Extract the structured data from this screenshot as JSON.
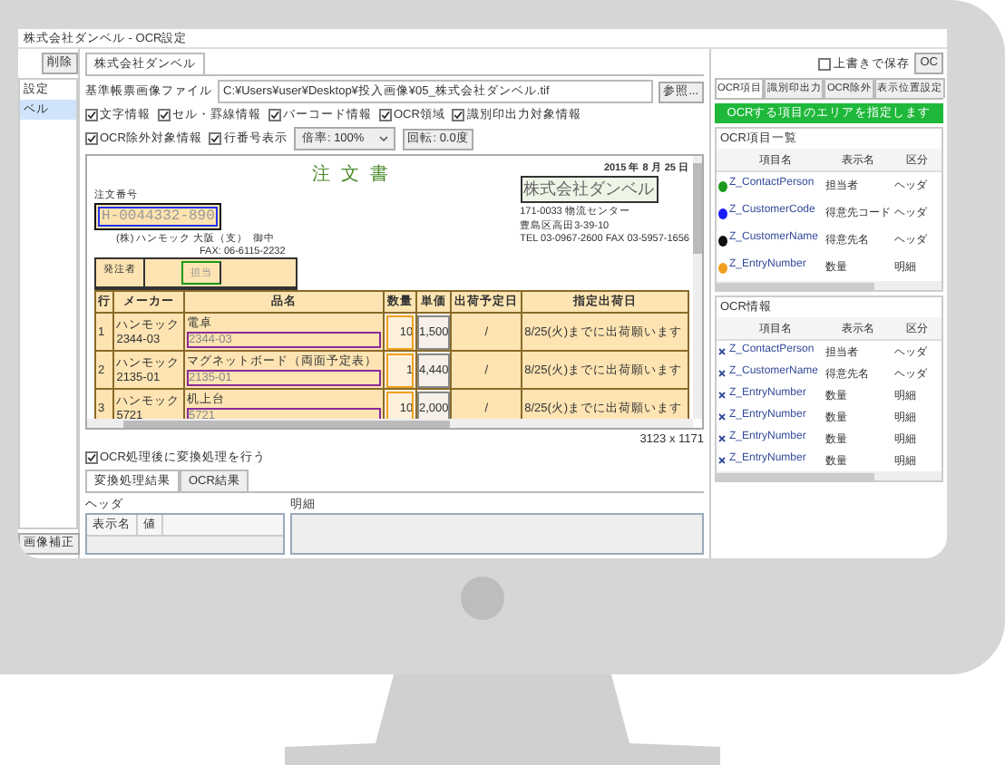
{
  "window": {
    "title": "株式会社ダンベル - OCR設定"
  },
  "left_panel": {
    "button": "削除",
    "items": [
      {
        "label": "設定",
        "selected": false
      },
      {
        "label": "ベル",
        "selected": true
      }
    ],
    "footer_button": "画像補正"
  },
  "document_tab": {
    "label": "株式会社ダンベル"
  },
  "file_row": {
    "label": "基準帳票画像ファイル",
    "value": "C:¥Users¥user¥Desktop¥投入画像¥05_株式会社ダンベル.tif",
    "button": "参照..."
  },
  "display_options": [
    {
      "label": "文字情報",
      "checked": true
    },
    {
      "label": "セル・罫線情報",
      "checked": true
    },
    {
      "label": "バーコード情報",
      "checked": true
    },
    {
      "label": "OCR領域",
      "checked": true
    },
    {
      "label": "識別印出力対象情報",
      "checked": true
    },
    {
      "label": "OCR除外対象情報",
      "checked": true
    },
    {
      "label": "行番号表示",
      "checked": true
    }
  ],
  "zoom_select": {
    "value": "倍率: 100%"
  },
  "rotate_button": "回転: 0.0度",
  "document": {
    "title": "注文書",
    "date": "2015 年 8 月 25 日",
    "order_label": "注文番号",
    "order_number": "H-0044332-890",
    "recipient": "(株) ハンモック 大阪（支）",
    "honorific": "御中",
    "fax": "FAX: 06-6115-2232",
    "company": "株式会社ダンベル",
    "address_lines": [
      "171-0033 物流センター",
      "豊島区高田3-39-10",
      "TEL 03-0967-2600 FAX 03-5957-1656"
    ],
    "orderer_label": "発注者",
    "orderer_value": "担当",
    "columns": [
      "行",
      "メーカー",
      "品名",
      "数量",
      "単価",
      "出荷予定日",
      "指定出荷日"
    ],
    "rows": [
      {
        "no": "1",
        "maker": "ハンモック",
        "maker_code": "2344-03",
        "item": "電卓",
        "item_code": "2344-03",
        "qty": "10",
        "price": "1,500",
        "ship_date": "/",
        "note": "8/25(火)までに出荷願います"
      },
      {
        "no": "2",
        "maker": "ハンモック",
        "maker_code": "2135-01",
        "item": "マグネットボード（両面予定表）",
        "item_code": "2135-01",
        "qty": "1",
        "price": "4,440",
        "ship_date": "/",
        "note": "8/25(火)までに出荷願います"
      },
      {
        "no": "3",
        "maker": "ハンモック",
        "maker_code": "5721",
        "item": "机上台",
        "item_code": "5721",
        "qty": "10",
        "price": "2,000",
        "ship_date": "/",
        "note": "8/25(火)までに出荷願います"
      }
    ]
  },
  "image_size": "3123 x 1171",
  "convert_option": {
    "label": "OCR処理後に変換処理を行う",
    "checked": true
  },
  "result_tabs": [
    {
      "label": "変換処理結果",
      "selected": true
    },
    {
      "label": "OCR結果",
      "selected": false
    }
  ],
  "header_section": {
    "label": "ヘッダ",
    "columns": [
      "表示名",
      "値"
    ]
  },
  "detail_section": {
    "label": "明細"
  },
  "right_panel": {
    "overwrite": {
      "label": "上書きで保存",
      "checked": false
    },
    "button": "OC",
    "tabs": [
      {
        "label": "OCR項目",
        "selected": true
      },
      {
        "label": "識別印出力",
        "selected": false
      },
      {
        "label": "OCR除外",
        "selected": false
      },
      {
        "label": "表示位置設定",
        "selected": false
      }
    ],
    "banner": "OCRする項目のエリアを指定します",
    "item_list": {
      "title": "OCR項目一覧",
      "columns": [
        "項目名",
        "表示名",
        "区分"
      ],
      "rows": [
        {
          "name": "Z_ContactPerson",
          "display": "担当者",
          "category": "ヘッダ",
          "color": "#1a9a1a"
        },
        {
          "name": "Z_CustomerCode",
          "display": "得意先コード",
          "category": "ヘッダ",
          "color": "#1a1aff"
        },
        {
          "name": "Z_CustomerName",
          "display": "得意先名",
          "category": "ヘッダ",
          "color": "#111111"
        },
        {
          "name": "Z_EntryNumber",
          "display": "数量",
          "category": "明細",
          "color": "#f0a020"
        }
      ]
    },
    "ocr_info": {
      "title": "OCR情報",
      "columns": [
        "項目名",
        "表示名",
        "区分"
      ],
      "rows": [
        {
          "name": "Z_ContactPerson",
          "display": "担当者",
          "category": "ヘッダ"
        },
        {
          "name": "Z_CustomerName",
          "display": "得意先名",
          "category": "ヘッダ"
        },
        {
          "name": "Z_EntryNumber",
          "display": "数量",
          "category": "明細"
        },
        {
          "name": "Z_EntryNumber",
          "display": "数量",
          "category": "明細"
        },
        {
          "name": "Z_EntryNumber",
          "display": "数量",
          "category": "明細"
        },
        {
          "name": "Z_EntryNumber",
          "display": "数量",
          "category": "明細"
        }
      ]
    }
  }
}
